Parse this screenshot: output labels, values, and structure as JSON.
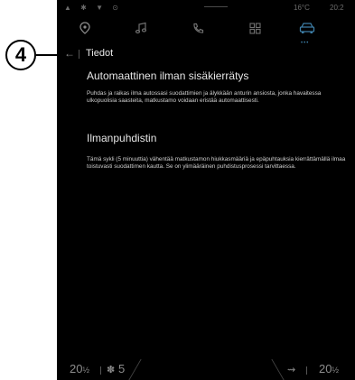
{
  "status_bar": {
    "icons": "▲ ✱ ▼ ⊙",
    "temperature": "16°C",
    "time": "20:2"
  },
  "nav": {
    "items": [
      {
        "name": "navigation",
        "icon": "location-pin-icon"
      },
      {
        "name": "music",
        "icon": "music-note-icon"
      },
      {
        "name": "phone",
        "icon": "phone-icon"
      },
      {
        "name": "apps",
        "icon": "apps-grid-icon"
      },
      {
        "name": "vehicle",
        "icon": "car-icon",
        "active": true
      }
    ],
    "active_color": "#3d7ea6"
  },
  "header": {
    "back_glyph": "←",
    "title": "Tiedot"
  },
  "sections": [
    {
      "title": "Automaattinen ilman sisäkierrätys",
      "body": "Puhdas ja raikas ilma autossasi suodattimien ja älykkään anturin ansiosta, jonka havaitessa ulkopuolisia saasteita, matkustamo voidaan eristää automaattisesti."
    },
    {
      "title": "Ilmanpuhdistin",
      "body": "Tämä sykli (5 minuuttia) vähentää matkustamon hiukkasmääriä ja epäpuhtauksia kierrättämällä ilmaa toistuvasti suodattimen kautta. Se on ylimääräinen puhdistusprosessi tarvittaessa."
    }
  ],
  "bottom_bar": {
    "temp_left": "20",
    "temp_left_unit": "½",
    "fan_glyph": "✽",
    "fan_level": "5",
    "seat_glyph": "⇝",
    "temp_right": "20",
    "temp_right_unit": "½"
  },
  "callout": {
    "number": "4"
  }
}
